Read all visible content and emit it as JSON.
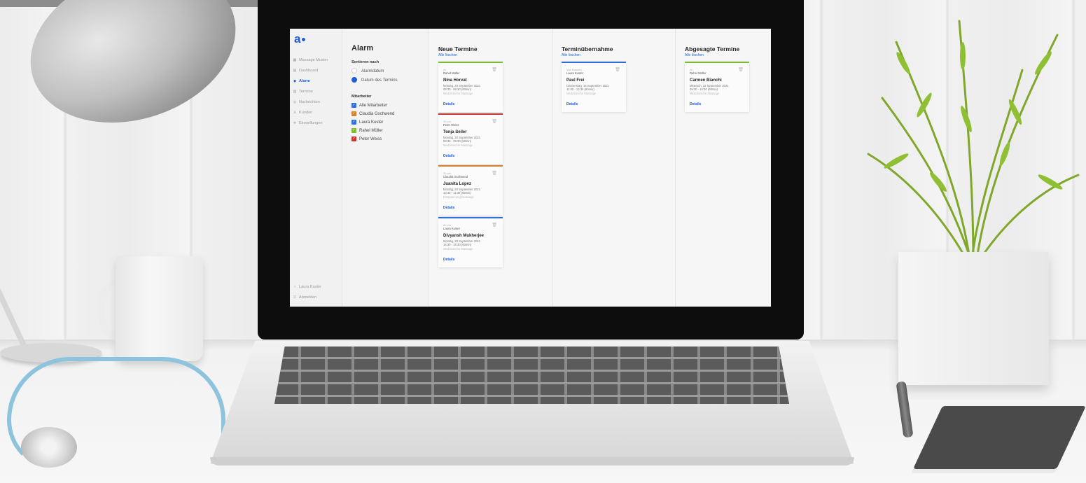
{
  "screen": {
    "sidebar": {
      "items": [
        {
          "label": "Massage Muster",
          "icon": "grid-icon"
        },
        {
          "label": "Dashboard",
          "icon": "dashboard-icon"
        },
        {
          "label": "Alarm",
          "icon": "alarm-icon",
          "active": true
        },
        {
          "label": "Termine",
          "icon": "calendar-icon"
        },
        {
          "label": "Nachrichten",
          "icon": "message-icon"
        },
        {
          "label": "Kunden",
          "icon": "person-icon"
        },
        {
          "label": "Einstellungen",
          "icon": "gear-icon"
        }
      ],
      "user": "Laura Kuster",
      "logout": "Abmelden"
    },
    "filter": {
      "title": "Alarm",
      "sort_heading": "Sortieren nach",
      "sort_options": [
        {
          "label": "Alarmdatum",
          "selected": false
        },
        {
          "label": "Datum des Termins",
          "selected": true
        }
      ],
      "staff_heading": "Mitarbeiter",
      "staff": [
        {
          "label": "Alle Mitarbeiter",
          "color": "#2f6fdc",
          "checked": true
        },
        {
          "label": "Claudia Gschwend",
          "color": "#d9802e",
          "checked": true
        },
        {
          "label": "Laura Kuster",
          "color": "#2f6fdc",
          "checked": true
        },
        {
          "label": "Rahel Müller",
          "color": "#7dbb2f",
          "checked": true
        },
        {
          "label": "Peter Weiss",
          "color": "#c8352c",
          "checked": true
        }
      ]
    },
    "columns": [
      {
        "title": "Neue Termine",
        "clear": "Alle löschen",
        "cards": [
          {
            "color": "#7dbb2f",
            "meta1": "2h",
            "meta2": "Rahel Müller",
            "name": "Nina Horvat",
            "date": "Montag, 20 September 2021",
            "time": "08:30 - 09:30 (60min)",
            "service": "Medizinische Massage",
            "details": "Details"
          },
          {
            "color": "#c8352c",
            "meta1": "2h vor",
            "meta2": "Peter Weiss",
            "name": "Tonja Seiler",
            "date": "Montag, 20 September 2021",
            "time": "08:30 - 09:30 (60min)",
            "service": "Medizinische Massage",
            "details": "Details"
          },
          {
            "color": "#d9802e",
            "meta1": "2h vor",
            "meta2": "Claudia Gschwend",
            "name": "Juanita Lopez",
            "date": "Montag, 20 September 2021",
            "time": "10:30 - 11:30 (60min)",
            "service": "Entspannungsmassage",
            "details": "Details"
          },
          {
            "color": "#2f6fdc",
            "meta1": "2h vor",
            "meta2": "Laura Kuster",
            "name": "Divyansh Mukherjee",
            "date": "Montag, 20 September 2021",
            "time": "14:30 - 15:30 (60min)",
            "service": "Medizinische Massage",
            "details": "Details"
          }
        ]
      },
      {
        "title": "Terminübernahme",
        "clear": "Alle löschen",
        "cards": [
          {
            "color": "#2f6fdc",
            "meta1": "Von Kunden",
            "meta2": "Laura Kuster",
            "name": "Paul Frei",
            "date": "Donnerstag, 16 September 2021",
            "time": "11:30 - 12:30 (60min)",
            "service": "Medizinische Massage",
            "details": "Details"
          }
        ]
      },
      {
        "title": "Abgesagte Termine",
        "clear": "Alle löschen",
        "cards": [
          {
            "color": "#7dbb2f",
            "meta1": "2h",
            "meta2": "Rahel Müller",
            "name": "Carmen Bianchi",
            "date": "Mittwoch, 22 September 2021",
            "time": "09:30 - 10:30 (60min)",
            "service": "Medizinische Massage",
            "details": "Details"
          }
        ]
      }
    ]
  }
}
